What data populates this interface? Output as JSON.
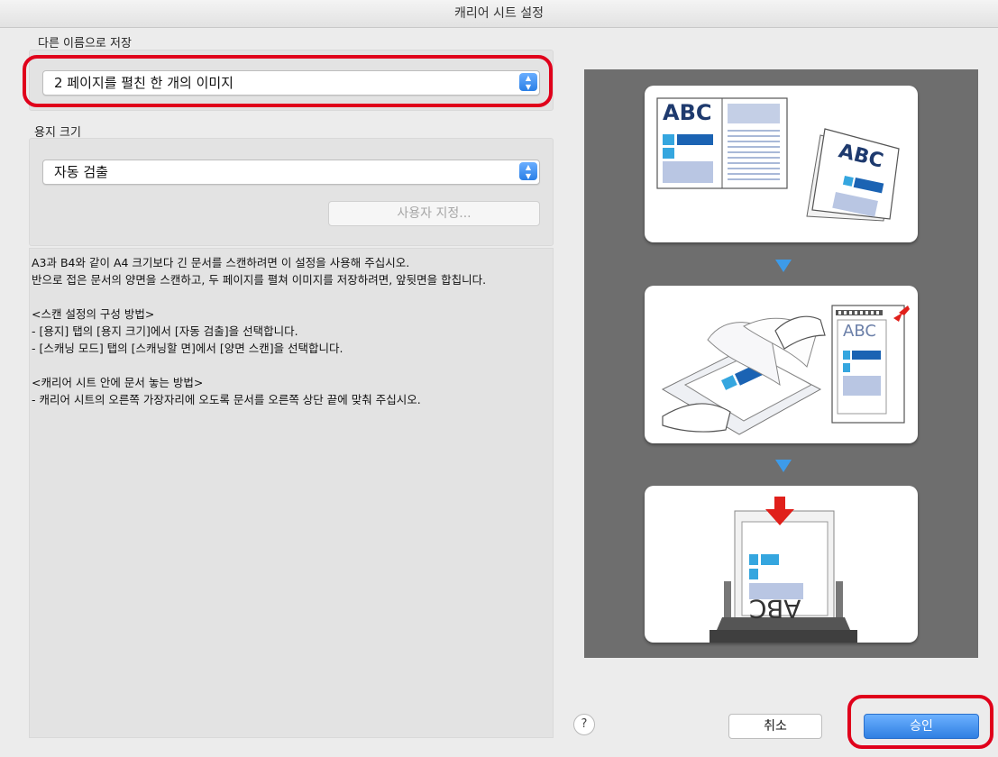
{
  "window": {
    "title": "캐리어 시트 설정"
  },
  "save_as": {
    "label": "다른 이름으로 저장",
    "selected": "2 페이지를 펼친 한 개의 이미지"
  },
  "paper_size": {
    "label": "용지 크기",
    "selected": "자동 검출",
    "custom_button": "사용자 지정..."
  },
  "description": {
    "line1": "A3과 B4와 같이 A4 크기보다 긴 문서를 스캔하려면 이 설정을 사용해 주십시오.",
    "line2": "반으로 접은 문서의 양면을 스캔하고, 두 페이지를 펼쳐 이미지를 저장하려면, 앞뒷면을 합칩니다.",
    "heading1": "<스캔 설정의 구성 방법>",
    "step1": "- [용지] 탭의 [용지 크기]에서 [자동 검출]을 선택합니다.",
    "step2": "- [스캐닝 모드] 탭의 [스캐닝할 면]에서 [양면 스캔]을 선택합니다.",
    "heading2": "<캐리어 시트 안에 문서 놓는 방법>",
    "step3": "- 캐리어 시트의 오른쪽 가장자리에 오도록 문서를 오른쪽 상단 끝에 맞춰 주십시오."
  },
  "illustration": {
    "card1_text_left": "ABC",
    "card1_text_right": "ABC",
    "card2_text": "ABC",
    "card3_text": "ABC"
  },
  "buttons": {
    "help": "?",
    "cancel": "취소",
    "ok": "승인"
  },
  "colors": {
    "highlight": "#e0001b",
    "accent_blue": "#2f7fe2",
    "illustration_blue": "#1b63b3"
  }
}
